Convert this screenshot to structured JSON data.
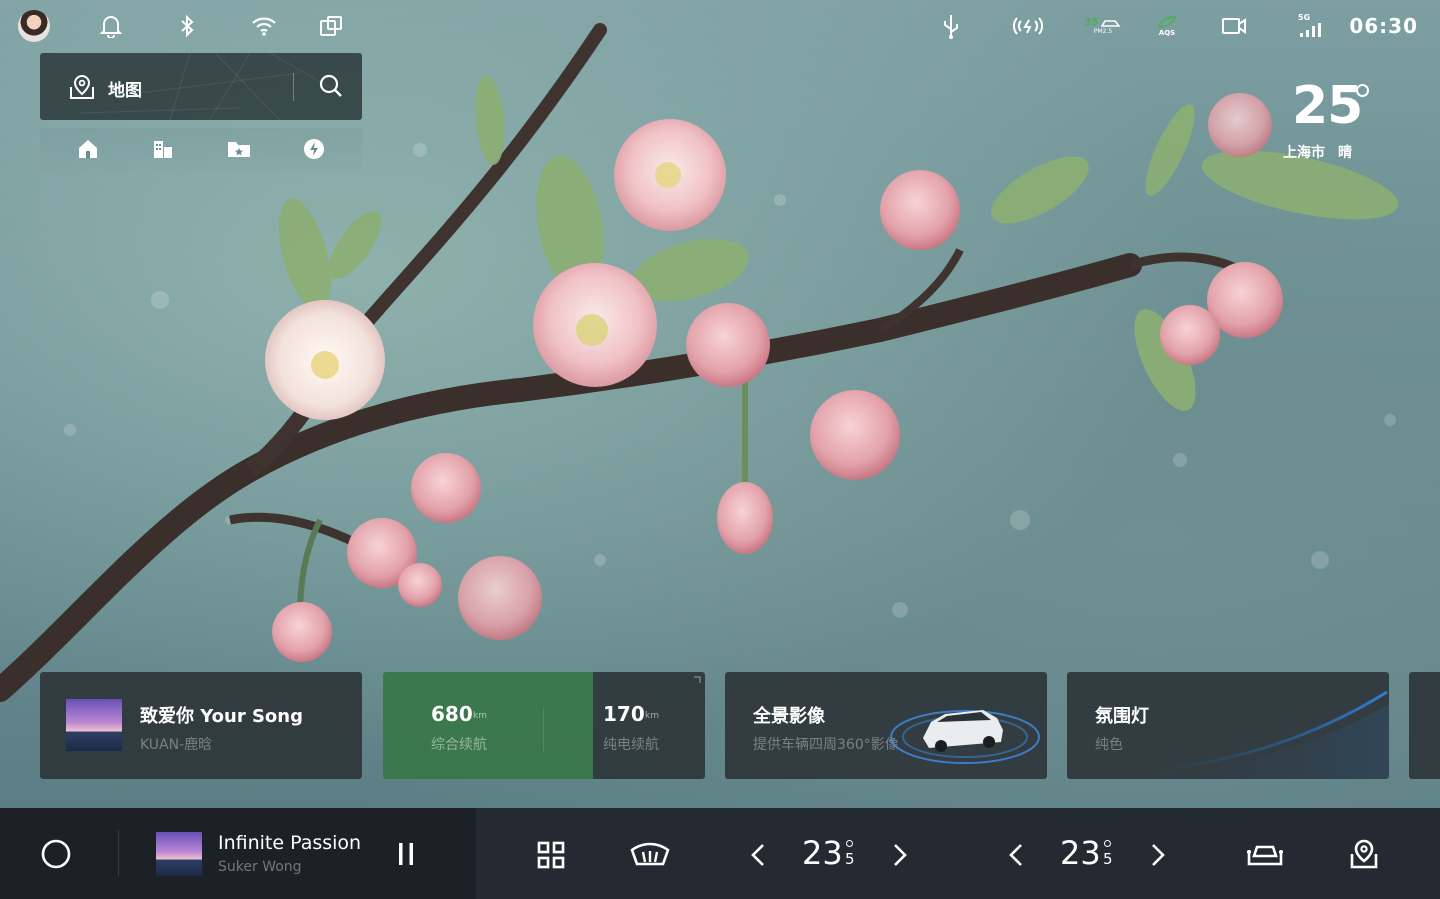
{
  "status_bar": {
    "time": "06:30",
    "pm25_value": "35",
    "pm25_label": "PM2.5",
    "aqs_label": "AQS",
    "network_label": "5G",
    "accent_green": "#4caf50"
  },
  "map_widget": {
    "label": "地图"
  },
  "weather": {
    "temperature": "25",
    "city": "上海市",
    "condition": "晴"
  },
  "cards": {
    "music": {
      "title": "致爱你 Your Song",
      "artist": "KUAN-鹿晗"
    },
    "range": {
      "total_value": "680",
      "total_unit": "km",
      "total_label": "综合续航",
      "electric_value": "170",
      "electric_unit": "km",
      "electric_label": "纯电续航"
    },
    "panorama": {
      "title": "全景影像",
      "subtitle": "提供车辆四周360°影像"
    },
    "ambient": {
      "title": "氛围灯",
      "subtitle": "纯色"
    }
  },
  "dock": {
    "now_playing_title": "Infinite Passion",
    "now_playing_artist": "Suker Wong",
    "left_temp_int": "23",
    "left_temp_dec": "5",
    "right_temp_int": "23",
    "right_temp_dec": "5"
  }
}
